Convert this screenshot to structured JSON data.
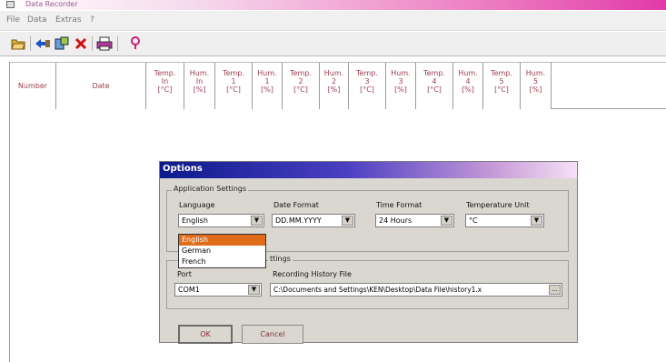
{
  "window": {
    "title": "Data Recorder"
  },
  "menu": [
    "File",
    "Data",
    "Extras",
    "?"
  ],
  "toolbar": {
    "icons": [
      "open-folder-icon",
      "import-icon",
      "device-icon",
      "delete-icon",
      "print-icon",
      "help-icon"
    ]
  },
  "table": {
    "headers": [
      "Number",
      "Date",
      "Temp.\nIn\n[°C]",
      "Hum.\nIn\n[%]",
      "Temp.\n1\n[°C]",
      "Hum.\n1\n[%]",
      "Temp.\n2\n[°C]",
      "Hum.\n2\n[%]",
      "Temp.\n3\n[°C]",
      "Hum.\n3\n[%]",
      "Temp.\n4\n[°C]",
      "Hum.\n4\n[%]",
      "Temp.\n5\n[°C]",
      "Hum.\n5\n[%]"
    ]
  },
  "dialog": {
    "title": "Options",
    "app_group": "Application Settings",
    "language_label": "Language",
    "language_value": "English",
    "language_options": [
      "English",
      "German",
      "French"
    ],
    "date_format_label": "Date Format",
    "date_format_value": "DD.MM.YYYY",
    "time_format_label": "Time Format",
    "time_format_value": "24 Hours",
    "temp_unit_label": "Temperature Unit",
    "temp_unit_value": "°C",
    "comm_group_visible": "ttings",
    "port_label": "Port",
    "port_value": "COM1",
    "history_label": "Recording History File",
    "history_value": "C:\\Documents and Settings\\KEN\\Desktop\\Data File\\history1.x",
    "browse_label": "...",
    "ok_label": "OK",
    "cancel_label": "Cancel"
  },
  "colors": {
    "title_gradient_end": "#e23aa8",
    "dialog_title_start": "#0c1a8c",
    "dropdown_highlight": "#e06c1a",
    "header_text": "#a03c50"
  }
}
